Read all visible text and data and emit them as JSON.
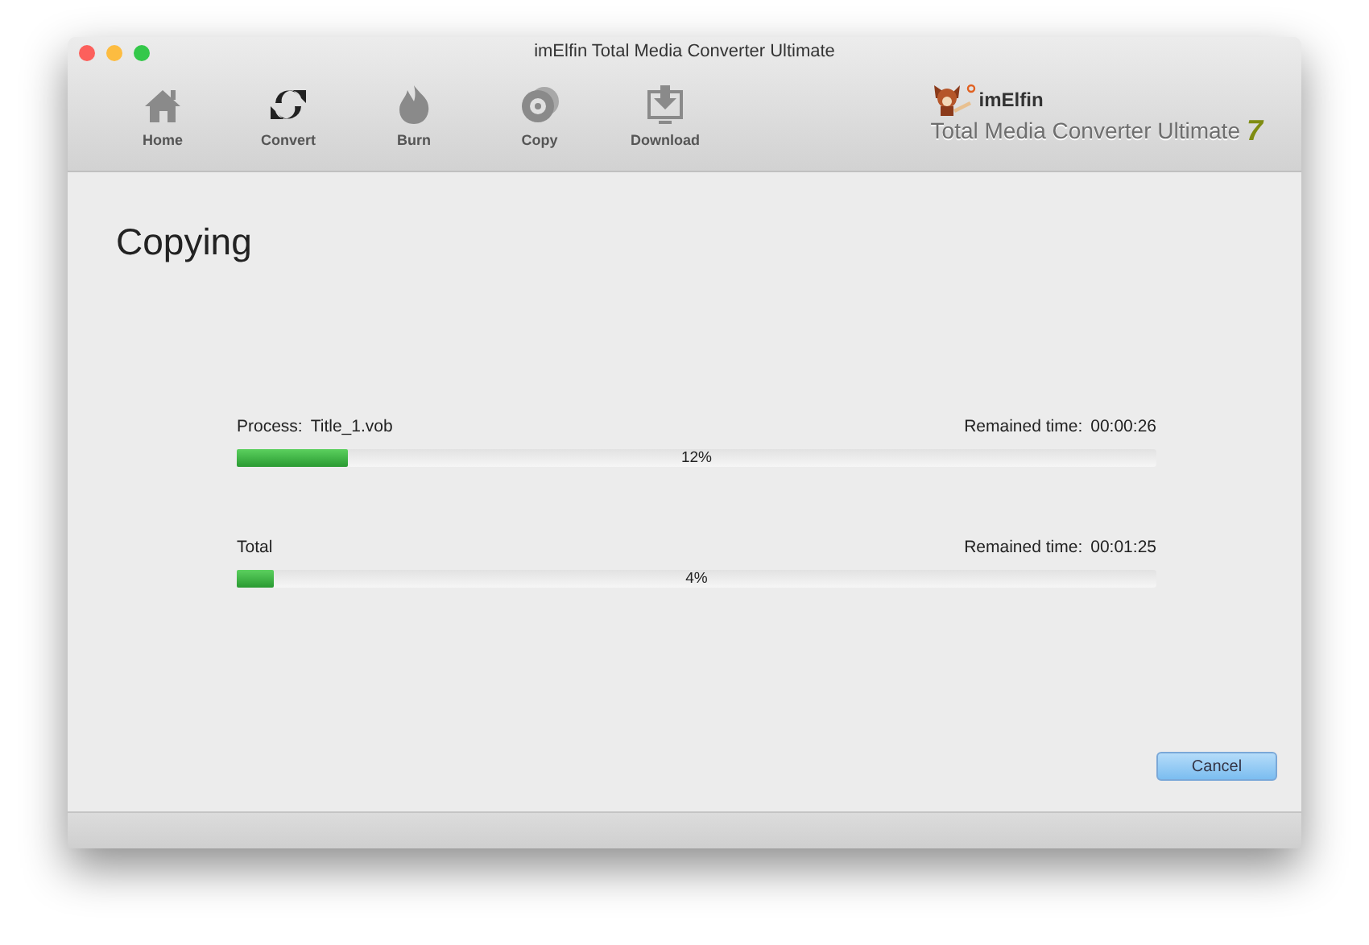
{
  "window": {
    "title": "imElfin Total Media Converter Ultimate"
  },
  "toolbar": [
    {
      "label": "Home",
      "kind": "home"
    },
    {
      "label": "Convert",
      "kind": "convert"
    },
    {
      "label": "Burn",
      "kind": "burn"
    },
    {
      "label": "Copy",
      "kind": "copy"
    },
    {
      "label": "Download",
      "kind": "download"
    }
  ],
  "brand": {
    "name": "imElfin",
    "product": "Total Media Converter Ultimate",
    "version": "7"
  },
  "heading": "Copying",
  "progress": [
    {
      "label": "Process:",
      "value": "Title_1.vob",
      "time_label": "Remained time:",
      "time": "00:00:26",
      "level": 0.12,
      "percent": "12%"
    },
    {
      "label": "Total",
      "time_label": "Remained time:",
      "time": "00:01:25",
      "level": 0.04,
      "percent": "4%"
    }
  ],
  "buttons": [
    "Cancel"
  ]
}
